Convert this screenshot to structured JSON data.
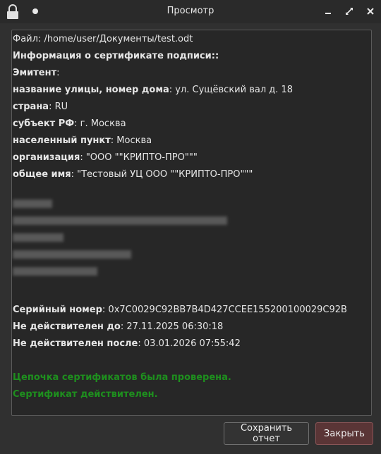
{
  "window": {
    "title": "Просмотр"
  },
  "colors": {
    "accent_green": "#1e8f1e",
    "close_button_bg": "#5a3536"
  },
  "icons": {
    "lock": "lock-icon",
    "dot": "window-menu-dot-icon",
    "minimize": "minimize-icon",
    "maximize": "maximize-icon",
    "close": "close-icon"
  },
  "report": {
    "file_label": "Файл:",
    "file_value": "/home/user/Документы/test.odt",
    "cert_info_heading": "Информация о сертификате подписи::",
    "issuer_label": "Эмитент",
    "issuer_colon": ":",
    "street_label": "название улицы, номер дома",
    "street_value": ": ул. Сущёвский вал д. 18",
    "country_label": "страна",
    "country_value": ": RU",
    "region_label": "субъект РФ",
    "region_value": ": г. Москва",
    "locality_label": "населенный пункт",
    "locality_value": ": Москва",
    "org_label": "организация",
    "org_value": ": \"ООО \"\"КРИПТО-ПРО\"\"\"",
    "cn_label": "общее имя",
    "cn_value": ": \"Тестовый УЦ ООО \"\"КРИПТО-ПРО\"\"\"",
    "serial_label": "Серийный номер",
    "serial_value": ": 0x7C0029C92BB7B4D427CCEE155200100029C92B",
    "not_before_label": "Не действителен до",
    "not_before_value": ": 27.11.2025 06:30:18",
    "not_after_label": "Не действителен после",
    "not_after_value": ": 03.01.2026 07:55:42",
    "chain_status": "Цепочка сертификатов была проверена.",
    "cert_status": "Сертификат действителен."
  },
  "buttons": {
    "save_report": "Сохранить отчет",
    "close": "Закрыть"
  }
}
